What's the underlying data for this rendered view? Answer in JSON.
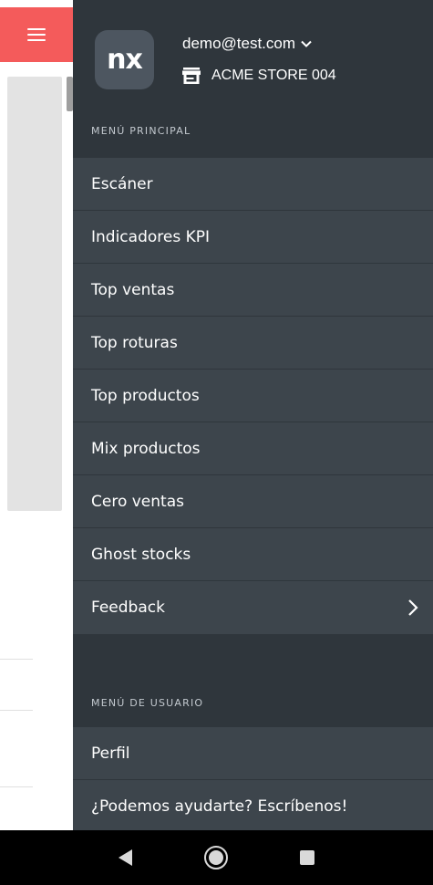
{
  "header": {
    "logo_text": "nx",
    "email": "demo@test.com",
    "store": "ACME STORE 004"
  },
  "main_menu": {
    "label": "MENÚ PRINCIPAL",
    "items": [
      {
        "label": "Escáner"
      },
      {
        "label": "Indicadores KPI"
      },
      {
        "label": "Top ventas"
      },
      {
        "label": "Top roturas"
      },
      {
        "label": "Top productos"
      },
      {
        "label": "Mix productos"
      },
      {
        "label": "Cero ventas"
      },
      {
        "label": "Ghost stocks"
      },
      {
        "label": "Feedback"
      }
    ]
  },
  "user_menu": {
    "label": "MENÚ DE USUARIO",
    "items": [
      {
        "label": "Perfil"
      },
      {
        "label": "¿Podemos ayudarte? Escríbenos!"
      }
    ]
  },
  "icons": {
    "menu": "hamburger-menu-icon",
    "email_dropdown": "chevron-down-icon",
    "store": "store-icon",
    "feedback_expand": "chevron-right-icon",
    "nav_back": "back-icon",
    "nav_home": "home-icon",
    "nav_recent": "recent-apps-icon"
  },
  "colors": {
    "accent": "#f45b5b",
    "drawer_bg": "#2f363c",
    "item_bg": "#3d454c"
  }
}
